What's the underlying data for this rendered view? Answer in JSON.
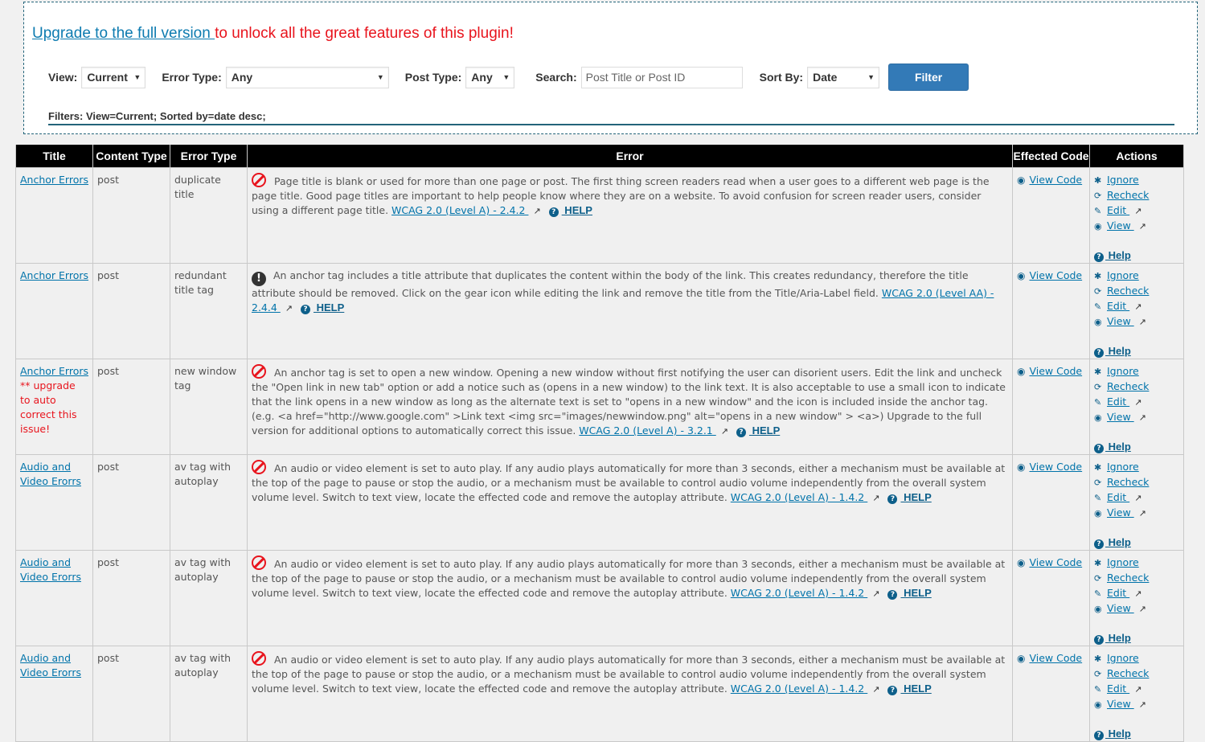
{
  "banner": {
    "upgrade_link": "Upgrade to the full version ",
    "upgrade_text": "to unlock all the great features of this plugin!"
  },
  "filters": {
    "view_label": "View:",
    "view_value": "Current",
    "error_type_label": "Error Type:",
    "error_type_value": "Any",
    "post_type_label": "Post Type:",
    "post_type_value": "Any",
    "search_label": "Search:",
    "search_placeholder": "Post Title or Post ID",
    "sort_label": "Sort By:",
    "sort_value": "Date",
    "filter_button": "Filter",
    "status": "Filters: View=Current; Sorted by=date desc;"
  },
  "table": {
    "headers": [
      "Title",
      "Content Type",
      "Error Type",
      "Error",
      "Effected Code",
      "Actions"
    ],
    "view_code_label": "View Code",
    "actions": {
      "ignore": "Ignore",
      "recheck": "Recheck",
      "edit": "Edit ",
      "view": "View ",
      "help": " Help"
    },
    "help_label": " HELP",
    "rows": [
      {
        "title": "Anchor Errors",
        "upsell": "",
        "content_type": "post",
        "error_type": "duplicate title",
        "severity": "error",
        "error": "Page title is blank or used for more than one page or post. The first thing screen readers read when a user goes to a different web page is the page title. Good page titles are important to help people know where they are on a website. To avoid confusion for screen reader users, consider using a different page title. ",
        "wcag": "WCAG 2.0 (Level A) - 2.4.2 "
      },
      {
        "title": "Anchor Errors",
        "upsell": "",
        "content_type": "post",
        "error_type": "redundant title tag",
        "severity": "warning",
        "error": "An anchor tag includes a title attribute that duplicates the content within the body of the link. This creates redundancy, therefore the title attribute should be removed. Click on the gear icon while editing the link and remove the title from the Title/Aria-Label field. ",
        "wcag": "WCAG 2.0 (Level AA) - 2.4.4 "
      },
      {
        "title": "Anchor Errors",
        "upsell": "** upgrade to auto correct this issue!",
        "content_type": "post",
        "error_type": "new window tag",
        "severity": "error",
        "error": "An anchor tag is set to open a new window. Opening a new window without first notifying the user can disorient users. Edit the link and uncheck the \"Open link in new tab\" option or add a notice such as (opens in a new window) to the link text. It is also acceptable to use a small icon to indicate that the link opens in a new window as long as the alternate text is set to \"opens in a new window\" and the icon is included inside the anchor tag.(e.g. <a href=\"http://www.google.com\" >Link text <img src=\"images/newwindow.png\" alt=\"opens in a new window\" > <a>) Upgrade to the full version for additional options to automatically correct this issue. ",
        "wcag": "WCAG 2.0 (Level A) - 3.2.1 "
      },
      {
        "title": "Audio and Video Erorrs",
        "upsell": "",
        "content_type": "post",
        "error_type": "av tag with autoplay",
        "severity": "error",
        "error": "An audio or video element is set to auto play. If any audio plays automatically for more than 3 seconds, either a mechanism must be available at the top of the page to pause or stop the audio, or a mechanism must be available to control audio volume independently from the overall system volume level. Switch to text view, locate the effected code and remove the autoplay attribute. ",
        "wcag": "WCAG 2.0 (Level A) - 1.4.2 "
      },
      {
        "title": "Audio and Video Erorrs",
        "upsell": "",
        "content_type": "post",
        "error_type": "av tag with autoplay",
        "severity": "error",
        "error": "An audio or video element is set to auto play. If any audio plays automatically for more than 3 seconds, either a mechanism must be available at the top of the page to pause or stop the audio, or a mechanism must be available to control audio volume independently from the overall system volume level. Switch to text view, locate the effected code and remove the autoplay attribute. ",
        "wcag": "WCAG 2.0 (Level A) - 1.4.2 "
      },
      {
        "title": "Audio and Video Erorrs",
        "upsell": "",
        "content_type": "post",
        "error_type": "av tag with autoplay",
        "severity": "error",
        "error": "An audio or video element is set to auto play. If any audio plays automatically for more than 3 seconds, either a mechanism must be available at the top of the page to pause or stop the audio, or a mechanism must be available to control audio volume independently from the overall system volume level. Switch to text view, locate the effected code and remove the autoplay attribute. ",
        "wcag": "WCAG 2.0 (Level A) - 1.4.2 "
      }
    ]
  },
  "colors": {
    "link": "#0073aa",
    "upsell_red": "#e8141d",
    "filter_button": "#337ab7",
    "header_bg": "#000000"
  }
}
